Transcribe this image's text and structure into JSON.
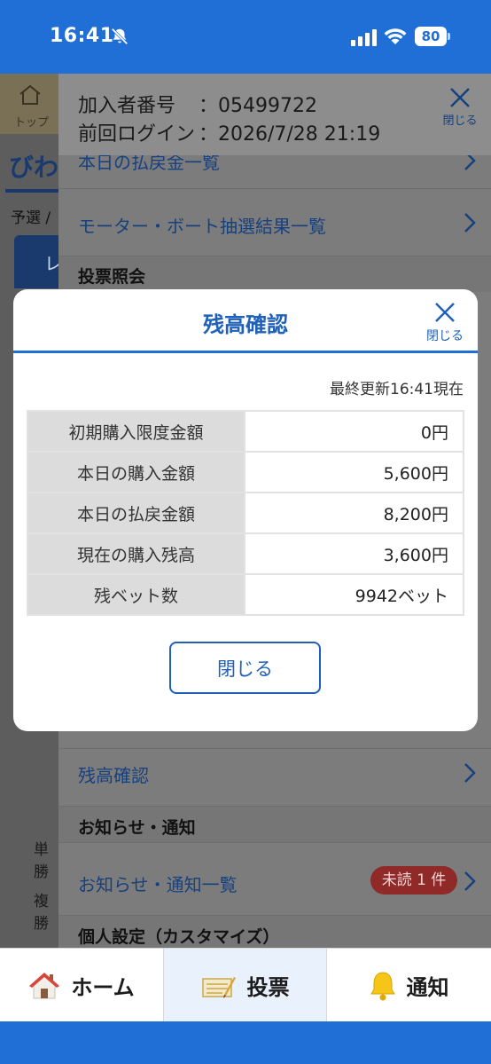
{
  "status_bar": {
    "time": "16:41",
    "battery": "80",
    "icons": [
      "bell-slash-icon",
      "signal-icon",
      "wifi-icon",
      "battery-icon"
    ]
  },
  "background": {
    "top_label": "トップ",
    "venue_partial": "びわ",
    "yosen_partial": "予選 /",
    "tab_partial": "レ",
    "tan_partial": "単勝",
    "fuku_partial": "複勝"
  },
  "drawer": {
    "member_no_label": "加入者番号",
    "member_no_value": "：05499722",
    "last_login_label": "前回ログイン",
    "last_login_value": "：2026/7/28 21:19",
    "close_label": "閉じる",
    "partial_link": "本日の払戻金一覧",
    "links": {
      "lottery_results": "モーター・ボート抽選結果一覧",
      "balance_check": "残高確認",
      "notice_list": "お知らせ・通知一覧"
    },
    "sections": {
      "vote_inquiry": "投票照会",
      "notices": "お知らせ・通知",
      "personal": "個人設定（カスタマイズ）"
    },
    "unread_badge": "未読 1 件"
  },
  "modal": {
    "title": "残高確認",
    "close_label": "閉じる",
    "updated": "最終更新16:41現在",
    "rows": [
      {
        "label": "初期購入限度金額",
        "value": "0円"
      },
      {
        "label": "本日の購入金額",
        "value": "5,600円"
      },
      {
        "label": "本日の払戻金額",
        "value": "8,200円"
      },
      {
        "label": "現在の購入残高",
        "value": "3,600円"
      },
      {
        "label": "残ベット数",
        "value": "9942ベット"
      }
    ],
    "close_button": "閉じる"
  },
  "tabbar": {
    "home": "ホーム",
    "vote": "投票",
    "notify": "通知",
    "active": "vote"
  },
  "colors": {
    "brand_blue": "#1f6fd6",
    "link_blue": "#1f61b8",
    "badge_red": "#c0392b"
  }
}
